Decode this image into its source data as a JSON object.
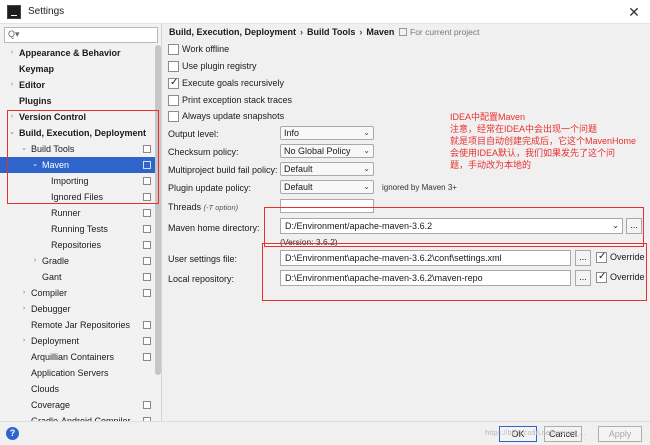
{
  "window": {
    "title": "Settings"
  },
  "search": {
    "placeholder": "Q▾"
  },
  "sidebar": {
    "items": [
      {
        "label": "Appearance & Behavior"
      },
      {
        "label": "Keymap"
      },
      {
        "label": "Editor"
      },
      {
        "label": "Plugins"
      },
      {
        "label": "Version Control"
      },
      {
        "label": "Build, Execution, Deployment"
      },
      {
        "label": "Build Tools"
      },
      {
        "label": "Maven"
      },
      {
        "label": "Importing"
      },
      {
        "label": "Ignored Files"
      },
      {
        "label": "Runner"
      },
      {
        "label": "Running Tests"
      },
      {
        "label": "Repositories"
      },
      {
        "label": "Gradle"
      },
      {
        "label": "Gant"
      },
      {
        "label": "Compiler"
      },
      {
        "label": "Debugger"
      },
      {
        "label": "Remote Jar Repositories"
      },
      {
        "label": "Deployment"
      },
      {
        "label": "Arquillian Containers"
      },
      {
        "label": "Application Servers"
      },
      {
        "label": "Clouds"
      },
      {
        "label": "Coverage"
      },
      {
        "label": "Gradle-Android Compiler"
      }
    ]
  },
  "breadcrumb": {
    "part1": "Build, Execution, Deployment",
    "sep": "›",
    "part2": "Build Tools",
    "part3": "Maven"
  },
  "for_project": "For current project",
  "checkboxes": {
    "work_offline": "Work offline",
    "use_plugin_registry": "Use plugin registry",
    "execute_goals": "Execute goals recursively",
    "print_exception": "Print exception stack traces",
    "always_update": "Always update snapshots"
  },
  "fields": {
    "output_level": {
      "label": "Output level:",
      "value": "Info"
    },
    "checksum_policy": {
      "label": "Checksum policy:",
      "value": "No Global Policy"
    },
    "fail_policy": {
      "label": "Multiproject build fail policy:",
      "value": "Default"
    },
    "plugin_update": {
      "label": "Plugin update policy:",
      "value": "Default",
      "hint": "ignored by Maven 3+"
    },
    "threads": {
      "label": "Threads",
      "hint": "(-T option)"
    },
    "maven_home": {
      "label": "Maven home directory:",
      "value": "D:/Environment/apache-maven-3.6.2",
      "version": "(Version: 3.6.2)"
    },
    "user_settings": {
      "label": "User settings file:",
      "value": "D:\\Environment\\apache-maven-3.6.2\\conf\\settings.xml",
      "override": "Override"
    },
    "local_repo": {
      "label": "Local repository:",
      "value": "D:\\Environment\\apache-maven-3.6.2\\maven-repo",
      "override": "Override"
    },
    "dots": "..."
  },
  "annotation": {
    "line1": "IDEA中配置Maven",
    "line2": "注意，经常在IDEA中会出现一个问题",
    "line3": "就是项目自动创建完成后，它这个MavenHome",
    "line4": "会使用IDEA默认，我们如果发先了这个问",
    "line5": "题，手动改为本地的"
  },
  "footer": {
    "ok": "OK",
    "cancel": "Cancel",
    "apply": "Apply",
    "help": "?"
  },
  "watermark": "https://blog.csdn.net/weixin_...",
  "colors": {
    "selection": "#2f65ca",
    "annotation_red": "#e8302e"
  }
}
